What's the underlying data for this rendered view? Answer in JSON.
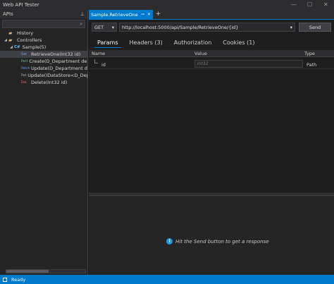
{
  "window": {
    "title": "Web API Tester",
    "minimize_icon": "minimize-icon",
    "maximize_icon": "maximize-icon",
    "close_icon": "close-icon"
  },
  "left_panel": {
    "title": "APIs",
    "pin_icon": "pin-icon",
    "search": {
      "value": "",
      "placeholder": ""
    },
    "tree": [
      {
        "label": "History",
        "kind": "folder",
        "level": 1
      },
      {
        "label": "Controllers",
        "kind": "folder",
        "level": 1
      },
      {
        "label": "Sample(5)",
        "kind": "controller",
        "level": 2
      },
      {
        "label": "RetrieveOne(Int32 id)",
        "verb": "Get",
        "level": 3,
        "selected": true
      },
      {
        "label": "Create(D_Department departm",
        "verb": "Post",
        "level": 3
      },
      {
        "label": "Update(D_Department departm",
        "verb": "Patch",
        "level": 3
      },
      {
        "label": "Update(IDataStore<D_Departm",
        "verb": "Put",
        "level": 3
      },
      {
        "label": "Delete(Int32 id)",
        "verb": "Del",
        "level": 3
      }
    ]
  },
  "tabs": {
    "active_label": "Sample.RetrieveOne",
    "add_label": "+"
  },
  "request": {
    "method": "GET",
    "url": "http://localhost:5000/api/Sample/RetrieveOne/{id}",
    "send_label": "Send",
    "tabs": [
      "Params",
      "Headers (3)",
      "Authorization",
      "Cookies (1)"
    ],
    "active_tab": "Params"
  },
  "params_table": {
    "columns": [
      "Name",
      "Value",
      "Type"
    ],
    "rows": [
      {
        "name": "id",
        "value_placeholder": "Int32",
        "type": "Path"
      }
    ]
  },
  "response": {
    "hint": "Hit the Send button to get a response",
    "icon": "info-icon"
  },
  "status": {
    "text": "Ready"
  },
  "colors": {
    "accent": "#007acc",
    "background": "#1e1e1e",
    "panel": "#252526"
  }
}
